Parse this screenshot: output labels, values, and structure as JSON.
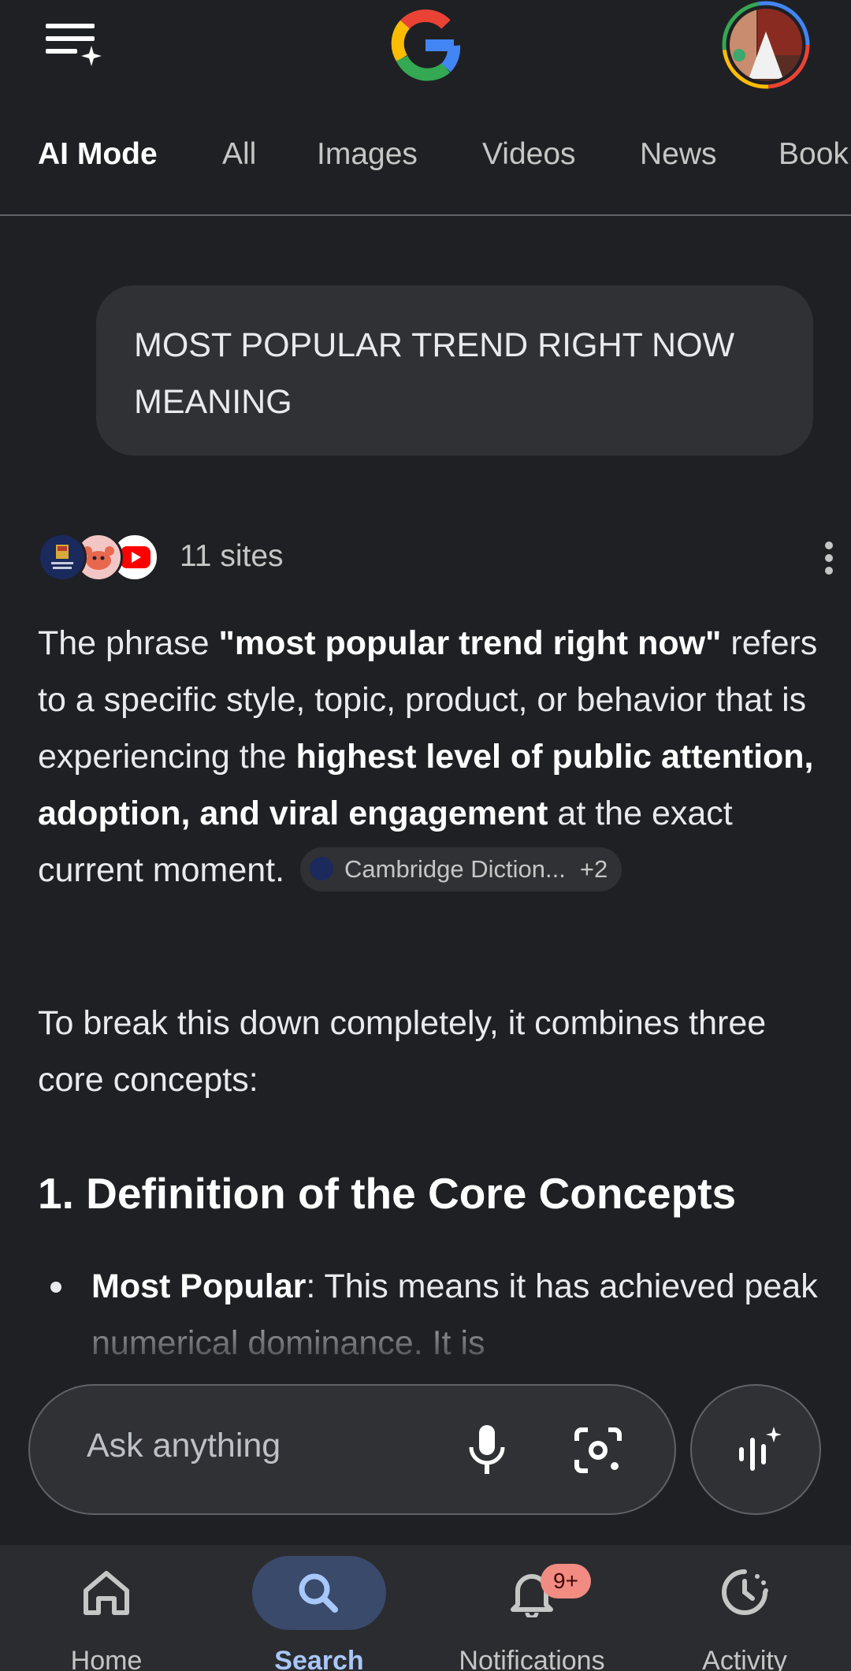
{
  "header": {
    "menu_icon": "menu-sparkle-icon",
    "logo": "google-g-logo",
    "avatar": "profile-avatar"
  },
  "tabs": [
    {
      "label": "AI Mode",
      "active": true
    },
    {
      "label": "All"
    },
    {
      "label": "Images"
    },
    {
      "label": "Videos"
    },
    {
      "label": "News"
    },
    {
      "label": "Book"
    }
  ],
  "query": {
    "line1": "MOST POPULAR TREND RIGHT NOW",
    "line2": "MEANING"
  },
  "sources": {
    "count_label": "11 sites",
    "icons": [
      "cambridge-dictionary-icon",
      "crab-avatar-icon",
      "youtube-icon"
    ]
  },
  "answer": {
    "p1_a": "The phrase ",
    "p1_bold1": "\"most popular trend right now\"",
    "p1_b": " refers to a specific style, topic, product, or behavior that is experiencing the ",
    "p1_bold2": "highest level of public attention, adoption, and viral engagement",
    "p1_c": " at the exact current moment.",
    "citation": {
      "label": "Cambridge Diction...",
      "extra": "+2"
    },
    "p2": "To break this down completely, it combines three core concepts:",
    "heading": "1. Definition of the Core Concepts",
    "bullet_bold": "Most Popular",
    "bullet_text": ": This means it has achieved peak numerical dominance. It is"
  },
  "askbar": {
    "placeholder": "Ask anything",
    "mic_icon": "microphone-icon",
    "lens_icon": "camera-lens-icon",
    "live_icon": "voice-live-icon"
  },
  "bottom_nav": [
    {
      "label": "Home",
      "icon": "home-icon"
    },
    {
      "label": "Search",
      "icon": "search-icon",
      "active": true
    },
    {
      "label": "Notifications",
      "icon": "bell-icon",
      "badge": "9+"
    },
    {
      "label": "Activity",
      "icon": "activity-icon"
    }
  ],
  "colors": {
    "background": "#1f2024",
    "surface": "#303134",
    "active_nav": "#a8c7fa",
    "badge": "#f28b82"
  }
}
